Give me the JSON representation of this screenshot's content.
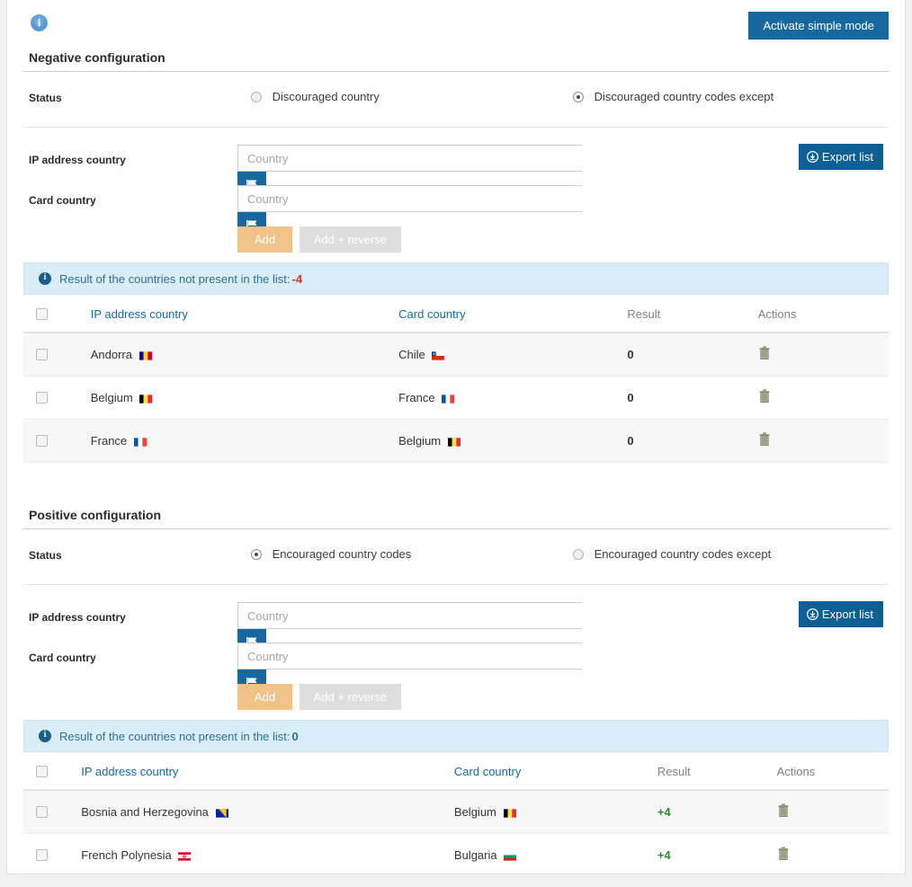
{
  "header": {
    "info_icon": "info-circle-icon",
    "simple_mode_label": "Activate simple mode"
  },
  "colors": {
    "primary_blue": "#15699f",
    "export_blue": "#0e5f94",
    "add_orange": "#f2c388",
    "disabled_gray": "#dedede",
    "alert_bg": "#d9edf7",
    "alert_text": "#31708f",
    "negative_red": "#d9342b",
    "positive_green": "#2a8b2a"
  },
  "negative": {
    "title": "Negative configuration",
    "status_label": "Status",
    "options": [
      {
        "label": "Discouraged country",
        "selected": false
      },
      {
        "label": "Discouraged country codes except",
        "selected": true
      }
    ],
    "ip_label": "IP address country",
    "ip_value": "",
    "ip_placeholder": "Country",
    "card_label": "Card country",
    "card_value": "",
    "card_placeholder": "Country",
    "export_label": "Export list",
    "add_label": "Add",
    "add_reverse_label": "Add + reverse",
    "alert_text": "Result of the countries not present in the list:",
    "alert_value": "-4",
    "columns": [
      "",
      "IP address country",
      "Card country",
      "Result",
      "Actions"
    ],
    "rows": [
      {
        "ip": "Andorra",
        "ip_flag": "ad",
        "card": "Chile",
        "card_flag": "cl",
        "result": "0",
        "result_sign": "zero"
      },
      {
        "ip": "Belgium",
        "ip_flag": "be",
        "card": "France",
        "card_flag": "fr",
        "result": "0",
        "result_sign": "zero"
      },
      {
        "ip": "France",
        "ip_flag": "fr",
        "card": "Belgium",
        "card_flag": "be",
        "result": "0",
        "result_sign": "zero"
      }
    ]
  },
  "positive": {
    "title": "Positive configuration",
    "status_label": "Status",
    "options": [
      {
        "label": "Encouraged country codes",
        "selected": true
      },
      {
        "label": "Encouraged country codes except",
        "selected": false
      }
    ],
    "ip_label": "IP address country",
    "ip_value": "",
    "ip_placeholder": "Country",
    "card_label": "Card country",
    "card_value": "",
    "card_placeholder": "Country",
    "export_label": "Export list",
    "add_label": "Add",
    "add_reverse_label": "Add + reverse",
    "alert_text": "Result of the countries not present in the list:",
    "alert_value": "0",
    "columns": [
      "",
      "IP address country",
      "Card country",
      "Result",
      "Actions"
    ],
    "rows": [
      {
        "ip": "Bosnia and Herzegovina",
        "ip_flag": "ba",
        "card": "Belgium",
        "card_flag": "be",
        "result": "+4",
        "result_sign": "pos"
      },
      {
        "ip": "French Polynesia",
        "ip_flag": "pf",
        "card": "Bulgaria",
        "card_flag": "bg",
        "result": "+4",
        "result_sign": "pos"
      }
    ]
  }
}
